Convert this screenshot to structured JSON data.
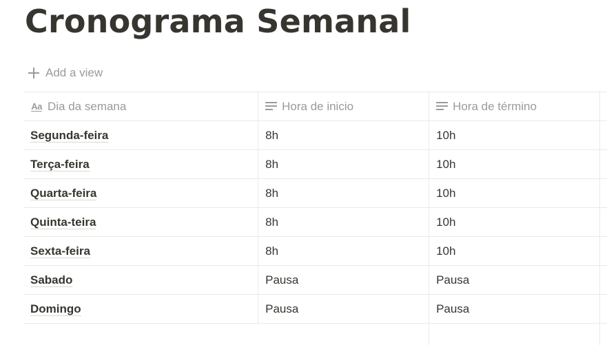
{
  "page": {
    "title": "Cronograma Semanal",
    "add_view_label": "Add a view"
  },
  "table": {
    "columns": [
      {
        "label": "Dia da semana",
        "icon": "text-aa-icon"
      },
      {
        "label": "Hora de inicio",
        "icon": "text-lines-icon"
      },
      {
        "label": "Hora de término",
        "icon": "text-lines-icon"
      }
    ],
    "rows": [
      {
        "day": "Segunda-feira",
        "start": "8h",
        "end": "10h"
      },
      {
        "day": "Terça-feira",
        "start": "8h",
        "end": "10h"
      },
      {
        "day": "Quarta-feira",
        "start": "8h",
        "end": "10h"
      },
      {
        "day": "Quinta-teira",
        "start": "8h",
        "end": "10h"
      },
      {
        "day": "Sexta-feira",
        "start": "8h",
        "end": "10h"
      },
      {
        "day": "Sabado",
        "start": "Pausa",
        "end": "Pausa"
      },
      {
        "day": "Domingo",
        "start": "Pausa",
        "end": "Pausa"
      }
    ]
  },
  "colors": {
    "text": "#37352f",
    "muted": "#9b9a97",
    "border": "#e9e9e7"
  }
}
